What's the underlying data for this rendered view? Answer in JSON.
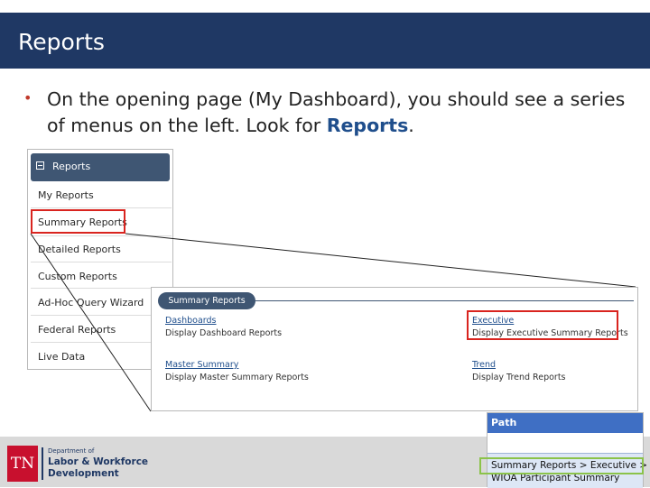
{
  "slide": {
    "title": "Reports",
    "bullet_text": "On the opening page (My Dashboard), you should see a series of menus on the left. Look for ",
    "bullet_highlight": "Reports",
    "bullet_end": "."
  },
  "menu": {
    "header": "Reports",
    "items": [
      "My Reports",
      "Summary Reports",
      "Detailed Reports",
      "Custom Reports",
      "Ad-Hoc Query Wizard",
      "Federal Reports",
      "Live Data"
    ]
  },
  "summary": {
    "tab": "Summary Reports",
    "dashboards_link": "Dashboards",
    "dashboards_desc": "Display Dashboard Reports",
    "executive_link": "Executive",
    "executive_desc": "Display Executive Summary Reports",
    "master_link": "Master Summary",
    "master_desc": "Display Master Summary Reports",
    "trend_link": "Trend",
    "trend_desc": "Display Trend Reports"
  },
  "path": {
    "header": "Path",
    "line1": "Summary Reports > Executive >",
    "line2": "WIOA Participant Summary"
  },
  "logo": {
    "abbr": "TN",
    "line1": "Department of",
    "line2": "Labor & Workforce",
    "line3": "Development"
  },
  "colors": {
    "header_bar": "#1f3864",
    "highlight_red": "#d9241f",
    "highlight_green": "#8bc34a",
    "accent_blue": "#1f4e8c"
  }
}
